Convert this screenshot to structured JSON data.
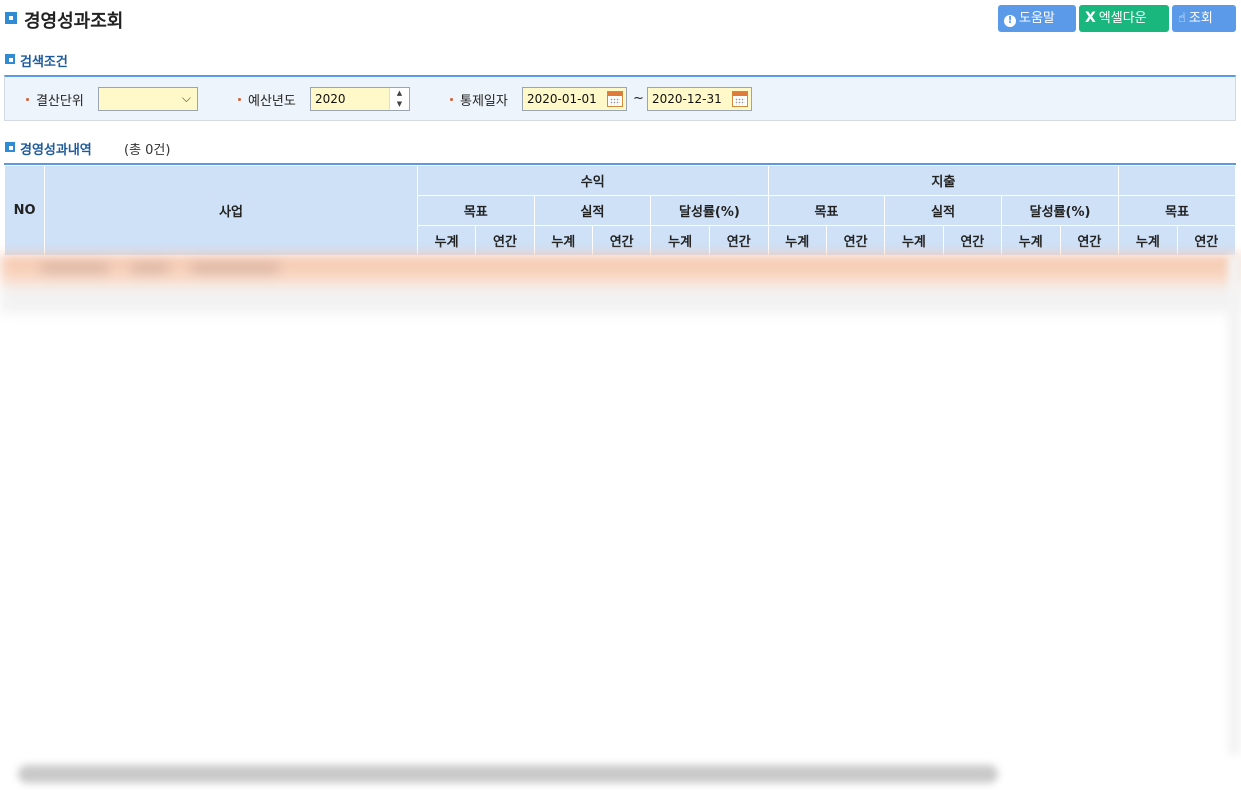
{
  "page": {
    "title": "경영성과조회",
    "buttons": {
      "help": "도움말",
      "excel": "엑셀다운",
      "search": "조회"
    }
  },
  "search": {
    "section_title": "검색조건",
    "settlement_unit_label": "결산단위",
    "settlement_unit_value": "",
    "budget_year_label": "예산년도",
    "budget_year_value": "2020",
    "control_date_label": "통제일자",
    "date_from": "2020-01-01",
    "date_separator": "~",
    "date_to": "2020-12-31"
  },
  "results": {
    "section_title": "경영성과내역",
    "count_text": "(총 0건)"
  },
  "grid": {
    "header_no": "NO",
    "header_business": "사업",
    "groups": [
      {
        "label": "수익",
        "subs": [
          {
            "label": "목표",
            "cols": [
              "누계",
              "연간"
            ]
          },
          {
            "label": "실적",
            "cols": [
              "누계",
              "연간"
            ]
          },
          {
            "label": "달성률(%)",
            "cols": [
              "누계",
              "연간"
            ]
          }
        ]
      },
      {
        "label": "지출",
        "subs": [
          {
            "label": "목표",
            "cols": [
              "누계",
              "연간"
            ]
          },
          {
            "label": "실적",
            "cols": [
              "누계",
              "연간"
            ]
          },
          {
            "label": "달성률(%)",
            "cols": [
              "누계",
              "연간"
            ]
          }
        ]
      },
      {
        "label": "",
        "subs": [
          {
            "label": "목표",
            "cols": [
              "누계",
              "연간"
            ]
          }
        ]
      }
    ]
  },
  "colors": {
    "accent": "#5b9ae8",
    "excel": "#19b77d",
    "header_bg": "#cfe1f7",
    "search_bg": "#eef4fb",
    "field_bg": "#fff8c8"
  }
}
